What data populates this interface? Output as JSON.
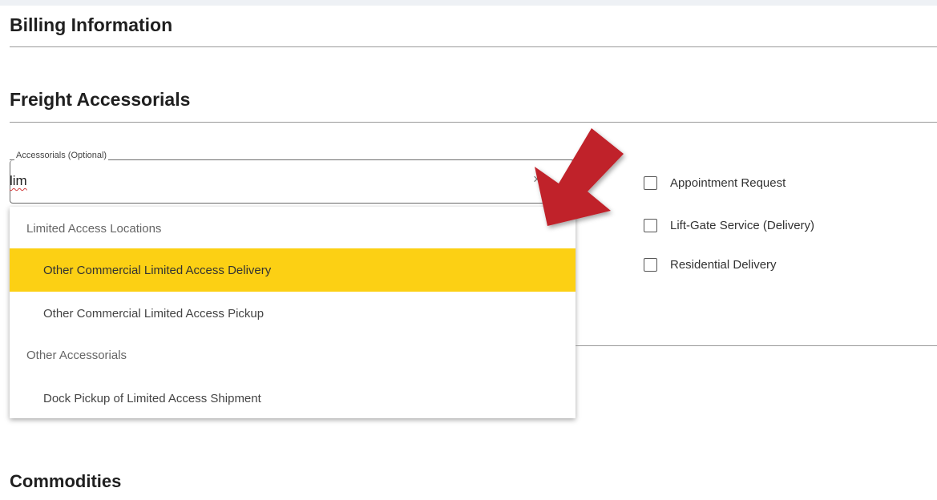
{
  "sections": {
    "billing_title": "Billing Information",
    "freight_title": "Freight Accessorials",
    "commodities_title": "Commodities"
  },
  "accessorials_field": {
    "label": "Accessorials (Optional)",
    "value": "lim",
    "clear_glyph": "×"
  },
  "dropdown": {
    "group1": "Limited Access Locations",
    "option1": "Other Commercial Limited Access Delivery",
    "option2": "Other Commercial Limited Access Pickup",
    "group2": "Other Accessorials",
    "option3": "Dock Pickup of Limited Access Shipment",
    "highlight_color": "#FCD014"
  },
  "checkboxes": [
    {
      "label": "Appointment Request",
      "checked": false
    },
    {
      "label": "Lift-Gate Service (Delivery)",
      "checked": false
    },
    {
      "label": "Residential Delivery",
      "checked": false
    }
  ],
  "annotation": {
    "arrow_color": "#C0202B",
    "icon": "arrow-pointer-icon"
  }
}
